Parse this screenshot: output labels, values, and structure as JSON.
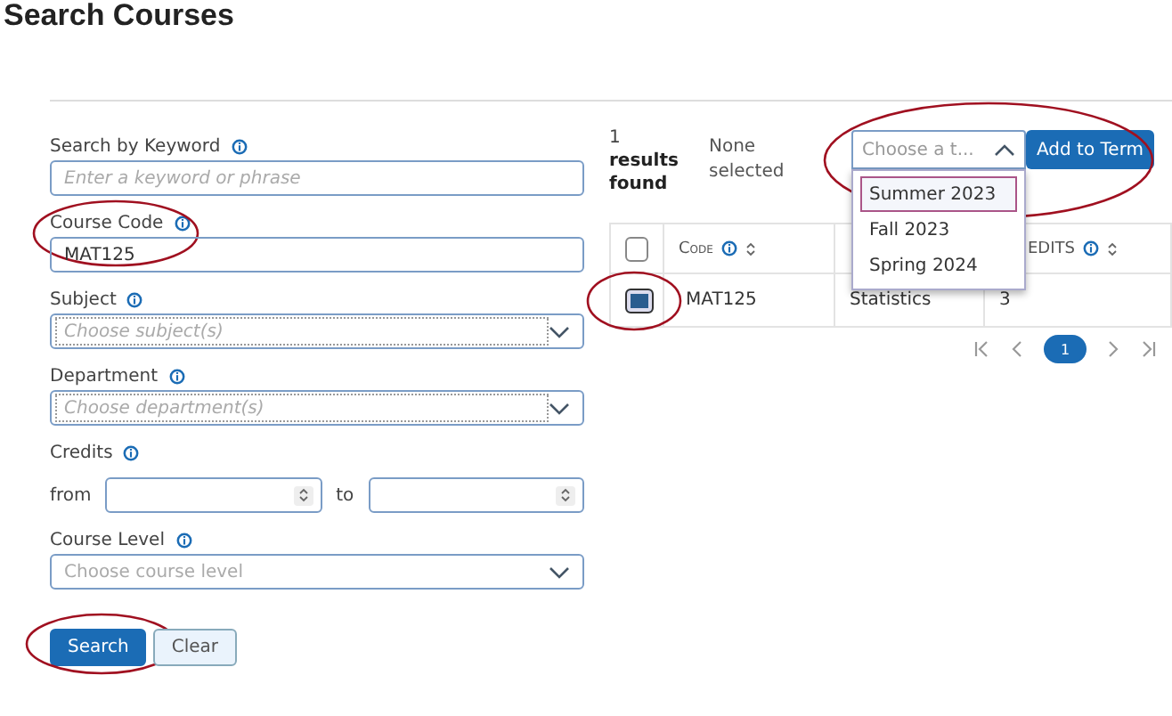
{
  "title": "Search Courses",
  "form": {
    "keyword": {
      "label": "Search by Keyword",
      "placeholder": "Enter a keyword or phrase"
    },
    "course_code": {
      "label": "Course Code",
      "value": "MAT125",
      "highlighted": true
    },
    "subject": {
      "label": "Subject",
      "placeholder": "Choose subject(s)"
    },
    "department": {
      "label": "Department",
      "placeholder": "Choose department(s)"
    },
    "credits": {
      "label": "Credits",
      "from_label": "from",
      "to_label": "to"
    },
    "course_level": {
      "label": "Course Level",
      "placeholder": "Choose course level"
    },
    "buttons": [
      {
        "label": "Search",
        "kind": "primary",
        "highlighted": true
      },
      {
        "label": "Clear",
        "kind": "secondary"
      }
    ]
  },
  "results": {
    "count": "1",
    "count_label": "results found",
    "selection": "None selected",
    "term_select": {
      "placeholder": "Choose a t...",
      "expanded": true,
      "highlighted": true,
      "options": [
        {
          "label": "Summer 2023",
          "selected": true
        },
        {
          "label": "Fall 2023",
          "selected": false
        },
        {
          "label": "Spring 2024",
          "selected": false
        }
      ]
    },
    "add_button": "Add to Term",
    "table": {
      "header_checked": false,
      "columns": [
        {
          "label": "Code",
          "info": true
        },
        {},
        {
          "label": "EDITS",
          "info": true
        }
      ],
      "rows": [
        {
          "checked": true,
          "highlighted": true,
          "cells": [
            "MAT125",
            "Statistics",
            "3"
          ]
        }
      ]
    },
    "pagination": {
      "pages": [
        {
          "label": "1",
          "selected": true
        }
      ]
    }
  }
}
